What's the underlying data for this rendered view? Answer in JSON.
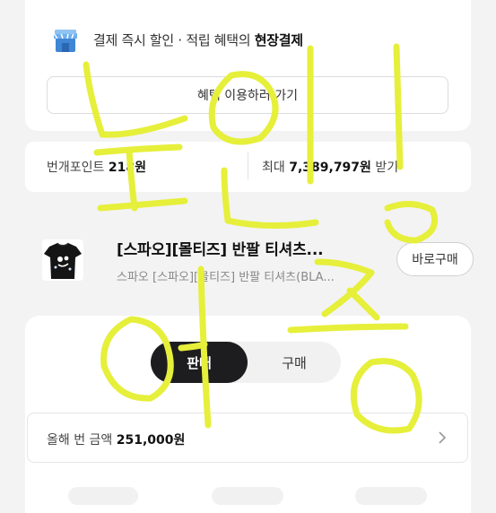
{
  "promo": {
    "icon": "store-icon",
    "text_prefix": "결제 즉시 할인 · 적립 혜택의 ",
    "text_bold": "현장결제",
    "button_label": "혜택 이용하러 가기"
  },
  "points": {
    "left_label": "번개포인트 ",
    "left_value": "218원",
    "right_prefix": "최대 ",
    "right_value": "7,389,797원",
    "right_suffix": " 받기"
  },
  "product": {
    "title": "[스파오][몰티즈] 반팔 티셔츠...",
    "subtitle": "스파오 [스파오][몰티즈] 반팔 티셔츠(BLA...",
    "buy_now_label": "바로구매"
  },
  "tabs": [
    {
      "label": "판매",
      "active": true
    },
    {
      "label": "구매",
      "active": false
    }
  ],
  "annual": {
    "label": "올해 번 금액 ",
    "value": "251,000원",
    "icon": "chevron-right-icon"
  },
  "handwriting": {
    "text": "본인 인증",
    "color": "#e6ef3a"
  },
  "colors": {
    "background": "#f3f3f4",
    "active_tab": "#1d1d1f",
    "handwriting": "#e6ef3a"
  }
}
